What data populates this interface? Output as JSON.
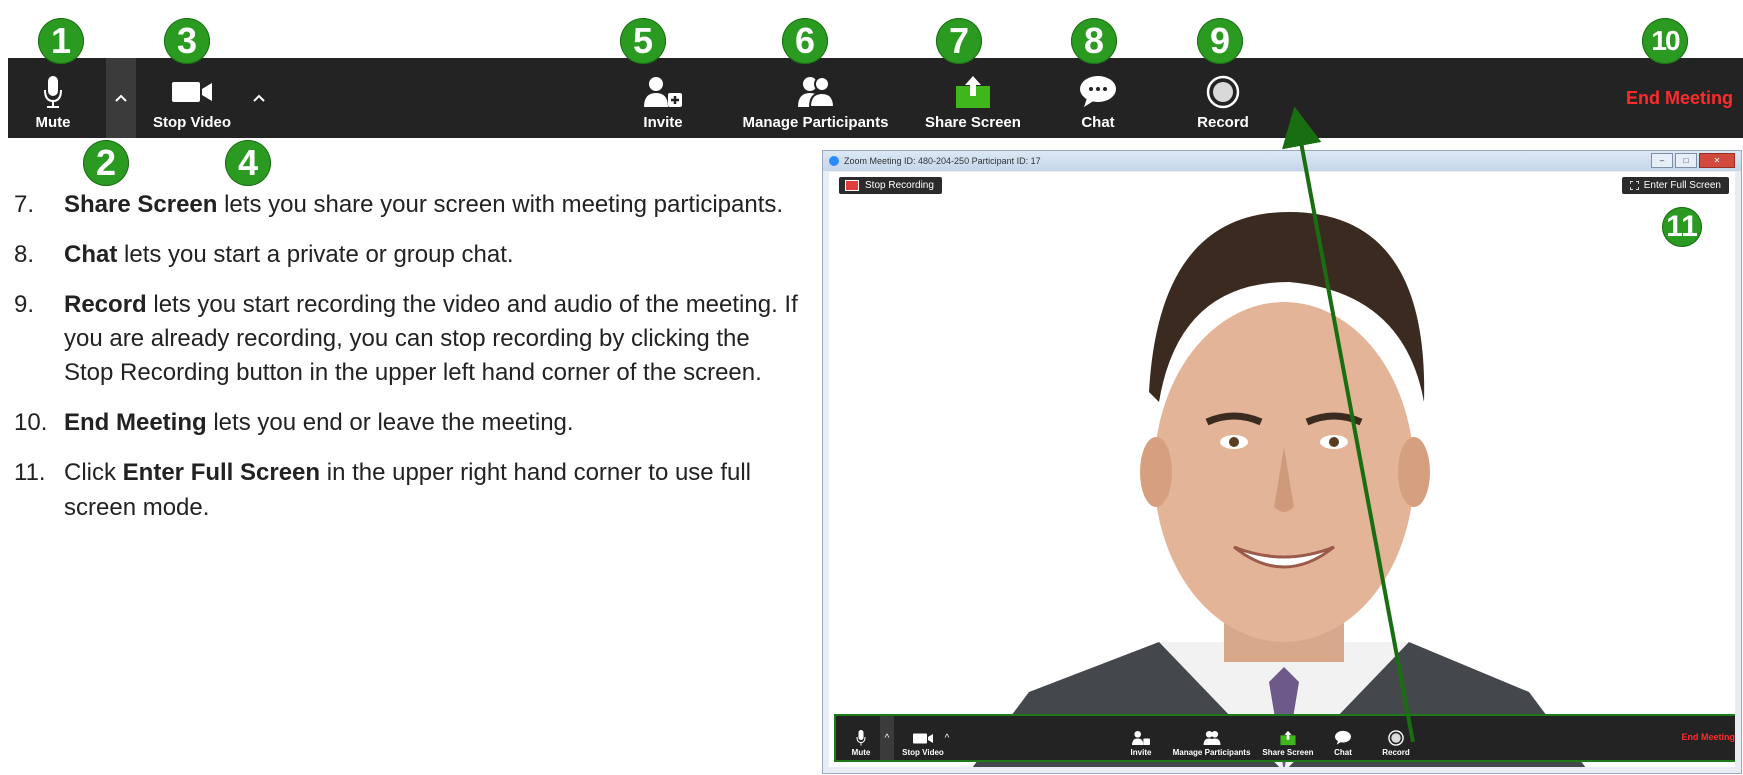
{
  "toolbar": {
    "mute_label": "Mute",
    "stop_video_label": "Stop Video",
    "invite_label": "Invite",
    "manage_participants_label": "Manage Participants",
    "share_screen_label": "Share Screen",
    "chat_label": "Chat",
    "record_label": "Record",
    "end_meeting_label": "End Meeting",
    "colors": {
      "background": "#232323",
      "end_meeting": "#ff2b2b",
      "share_icon": "#3fb61a"
    }
  },
  "badges": [
    "1",
    "2",
    "3",
    "4",
    "5",
    "6",
    "7",
    "8",
    "9",
    "10",
    "11"
  ],
  "badge_color": "#2a9b20",
  "instructions": [
    {
      "num": "7.",
      "bold": "Share Screen",
      "before": "",
      "after": " lets you share your screen with meeting participants."
    },
    {
      "num": "8.",
      "bold": "Chat",
      "before": "",
      "after": " lets you start a private or group chat."
    },
    {
      "num": "9.",
      "bold": "Record",
      "before": "",
      "after": " lets you start recording the video and audio of the meeting. If you are already recording, you can stop recording by clicking the Stop Recording button in the upper left hand corner of the screen."
    },
    {
      "num": "10.",
      "bold": "End Meeting",
      "before": "",
      "after": " lets you end or leave the meeting."
    },
    {
      "num": "11.",
      "bold": "Enter Full Screen",
      "before": "Click ",
      "after": " in the upper right hand corner to use full screen mode."
    }
  ],
  "window": {
    "title": "Zoom Meeting ID: 480-204-250 Participant ID: 17",
    "stop_recording_label": "Stop Recording",
    "enter_full_screen_label": "Enter Full Screen",
    "mini_toolbar": {
      "mute_label": "Mute",
      "stop_video_label": "Stop Video",
      "invite_label": "Invite",
      "manage_participants_label": "Manage Participants",
      "share_screen_label": "Share Screen",
      "chat_label": "Chat",
      "record_label": "Record",
      "end_meeting_label": "End Meeting"
    }
  }
}
